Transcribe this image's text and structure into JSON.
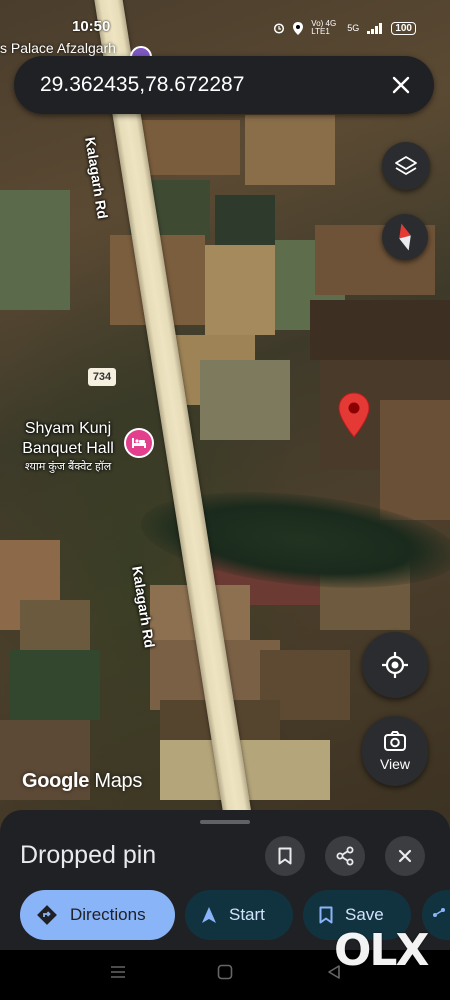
{
  "status_bar": {
    "time": "10:50",
    "network_label": "Vo) 4G LTE1",
    "signal_label": "5G",
    "battery": "100"
  },
  "map": {
    "place_label_top": "s Palace Afzalgarh",
    "road_name": "Kalagarh Rd",
    "route_shield": "734",
    "poi": {
      "name_line1": "Shyam Kunj",
      "name_line2": "Banquet Hall",
      "name_hindi": "श्याम कुंज बैंक्वेट हॉल",
      "icon": "hotel-icon",
      "color": "#e43f8d"
    },
    "dropped_pin_color": "#e53935",
    "attribution_google": "Google",
    "attribution_maps": "Maps"
  },
  "search": {
    "coordinates": "29.362435,78.672287"
  },
  "controls": {
    "layers_icon": "layers-icon",
    "compass_icon": "compass-icon",
    "location_icon": "my-location-icon",
    "view_label": "View"
  },
  "sheet": {
    "title": "Dropped pin",
    "actions": [
      {
        "label": "Directions",
        "icon": "directions-icon"
      },
      {
        "label": "Start",
        "icon": "navigation-arrow-icon"
      },
      {
        "label": "Save",
        "icon": "bookmark-icon"
      }
    ]
  },
  "watermark": "OLX",
  "colors": {
    "sheet_bg": "#202124",
    "primary_chip": "#8ab4f8",
    "secondary_chip": "#11333f"
  }
}
